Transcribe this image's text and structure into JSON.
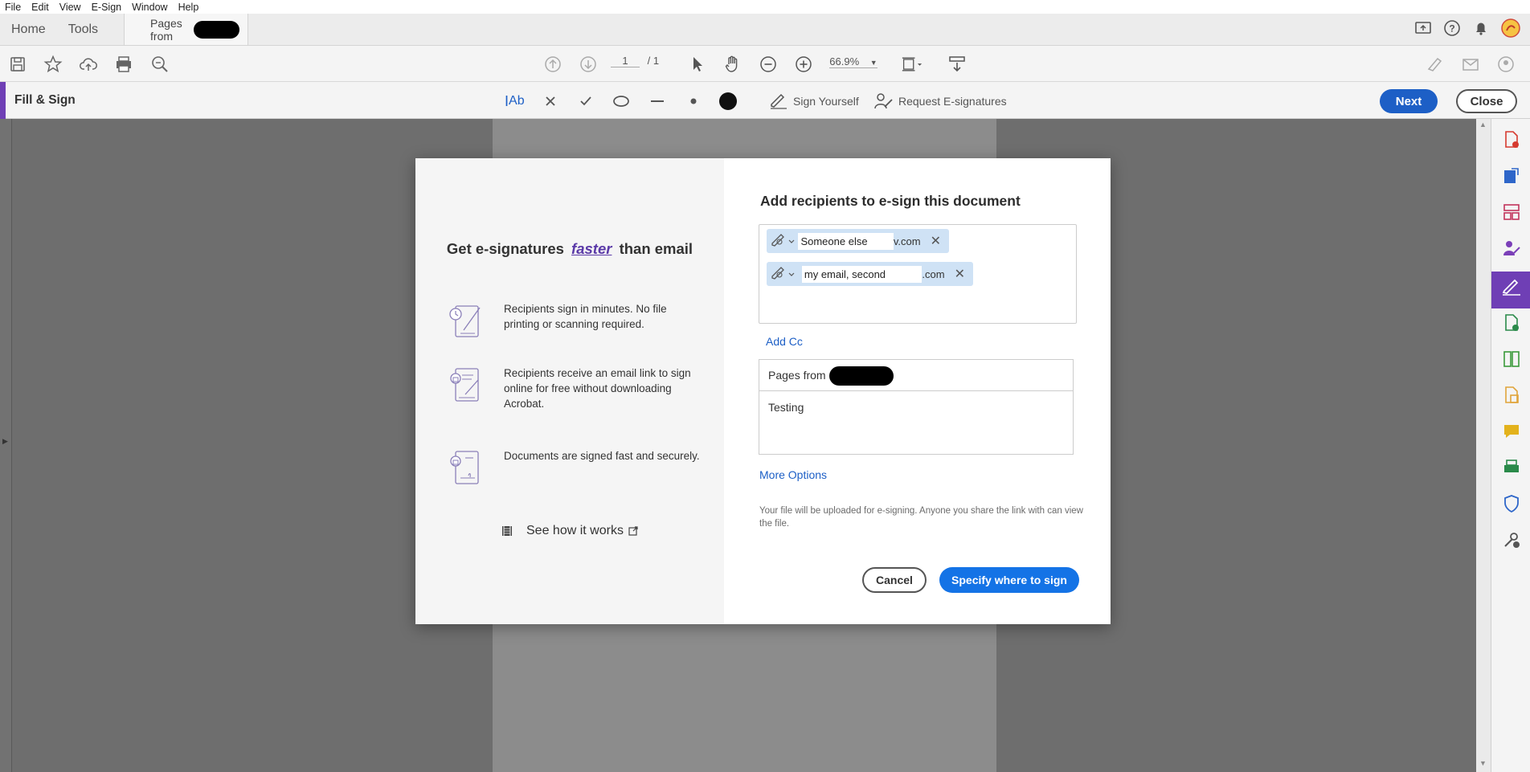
{
  "menubar": {
    "items": [
      "File",
      "Edit",
      "View",
      "E-Sign",
      "Window",
      "Help"
    ]
  },
  "tabs": {
    "home": "Home",
    "tools": "Tools",
    "document_prefix": "Pages from"
  },
  "toolbar": {
    "page_current": "1",
    "page_total": "/ 1",
    "zoom": "66.9%"
  },
  "fillsign": {
    "title": "Fill & Sign",
    "text_tool": "Ab",
    "sign_yourself": "Sign Yourself",
    "request_esignatures": "Request E-signatures",
    "next": "Next",
    "close": "Close"
  },
  "dialog": {
    "left": {
      "heading_before": "Get e-signatures",
      "heading_emphasis": "faster",
      "heading_after": "than email",
      "features": [
        {
          "text": "Recipients sign in minutes. No file printing or scanning required."
        },
        {
          "text": "Recipients receive an email link to sign online for free without downloading Acrobat."
        },
        {
          "text": "Documents are signed fast and securely."
        }
      ],
      "see_how": "See how it works"
    },
    "right": {
      "title": "Add recipients to e-sign this document",
      "recipients": [
        {
          "value": "Someone else",
          "suffix": "v.com",
          "remove": "✕"
        },
        {
          "value": "my email, second",
          "suffix": ".com",
          "remove": "✕"
        }
      ],
      "add_cc": "Add Cc",
      "document_name_prefix": "Pages from",
      "message": "Testing",
      "more_options": "More Options",
      "note": "Your file will be uploaded for e-signing. Anyone you share the link with can view the file.",
      "cancel": "Cancel",
      "specify": "Specify where to sign"
    }
  },
  "colors": {
    "accent_purple": "#6f3fb5",
    "primary_blue": "#1473e6",
    "link_blue": "#1d5fc6"
  }
}
